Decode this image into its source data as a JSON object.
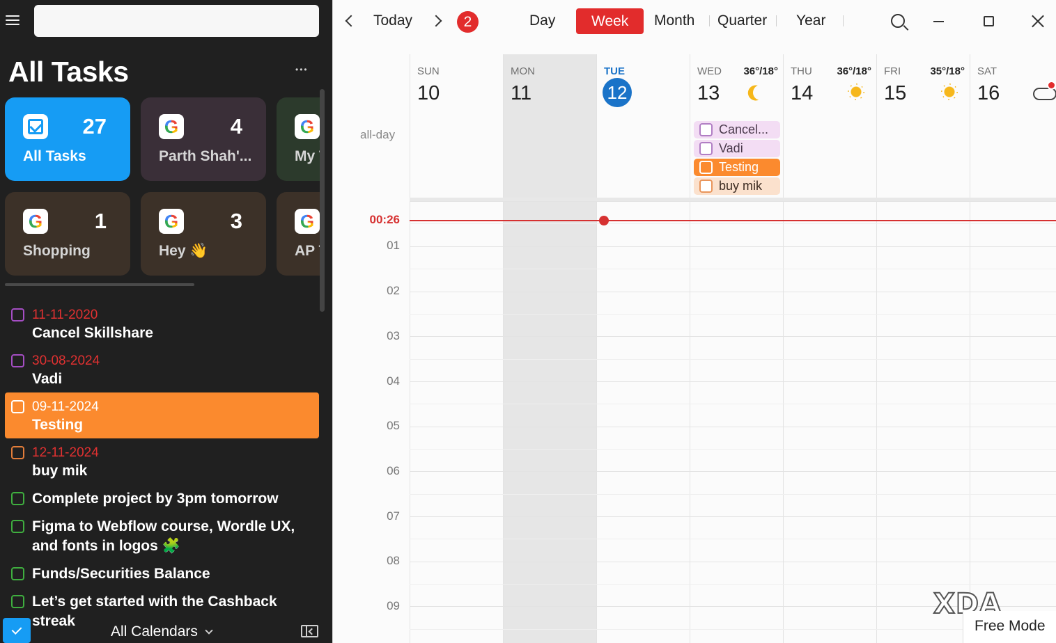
{
  "search": {
    "placeholder": ""
  },
  "sidebar": {
    "title": "All Tasks",
    "tiles": [
      {
        "name": "All Tasks",
        "count": "27",
        "icon": "check-icon",
        "color": "#169cf4"
      },
      {
        "name": "Parth Shah'...",
        "count": "4",
        "icon": "google-icon",
        "color": "#3a2f38"
      },
      {
        "name": "My T",
        "count": "",
        "icon": "google-icon",
        "color": "#2c3a2c"
      },
      {
        "name": "Shopping",
        "count": "1",
        "icon": "google-icon",
        "color": "#3c3128"
      },
      {
        "name": "Hey 👋",
        "count": "3",
        "icon": "google-icon",
        "color": "#3c3128"
      },
      {
        "name": "AP T",
        "count": "",
        "icon": "google-icon",
        "color": "#3c3128"
      }
    ],
    "tasks": [
      {
        "date": "11-11-2020",
        "title": "Cancel Skillshare",
        "color": "#a54ec4"
      },
      {
        "date": "30-08-2024",
        "title": "Vadi",
        "color": "#a54ec4"
      },
      {
        "date": "09-11-2024",
        "title": "Testing",
        "color": "#ffffff"
      },
      {
        "date": "12-11-2024",
        "title": "buy mik",
        "color": "#e27d3a"
      },
      {
        "date": "",
        "title": "Complete project by 3pm tomorrow",
        "color": "#3fae3f"
      },
      {
        "date": "",
        "title": "Figma to Webflow course, Wordle UX, and fonts in logos 🧩",
        "color": "#3fae3f"
      },
      {
        "date": "",
        "title": "Funds/Securities Balance",
        "color": "#3fae3f"
      },
      {
        "date": "",
        "title": "Let’s get started with the Cashback streak",
        "color": "#3fae3f"
      }
    ],
    "footer": {
      "calendars_label": "All Calendars"
    }
  },
  "toolbar": {
    "today_label": "Today",
    "badge_count": "2",
    "views": [
      "Day",
      "Week",
      "Month",
      "Quarter",
      "Year"
    ],
    "active_view": "Week"
  },
  "week": {
    "days": [
      {
        "name": "SUN",
        "num": "10",
        "temp": "",
        "weather": ""
      },
      {
        "name": "MON",
        "num": "11",
        "temp": "",
        "weather": ""
      },
      {
        "name": "TUE",
        "num": "12",
        "temp": "",
        "weather": "",
        "today": true
      },
      {
        "name": "WED",
        "num": "13",
        "temp": "36°/18°",
        "weather": "moon-icon"
      },
      {
        "name": "THU",
        "num": "14",
        "temp": "36°/18°",
        "weather": "sun-icon"
      },
      {
        "name": "FRI",
        "num": "15",
        "temp": "35°/18°",
        "weather": "sun-icon"
      },
      {
        "name": "SAT",
        "num": "16",
        "temp": "",
        "weather": "cloud-icon"
      }
    ],
    "allday_label": "all-day",
    "allday_events": [
      {
        "title": "Cancel...",
        "style": "purple"
      },
      {
        "title": "Vadi",
        "style": "purple"
      },
      {
        "title": "Testing",
        "style": "orange"
      },
      {
        "title": "buy mik",
        "style": "peach"
      }
    ],
    "now_label": "00:26",
    "hours": [
      "01",
      "02",
      "03",
      "04",
      "05",
      "06",
      "07",
      "08",
      "09"
    ]
  },
  "watermark": {
    "logo": "XDA",
    "mode": "Free Mode"
  }
}
